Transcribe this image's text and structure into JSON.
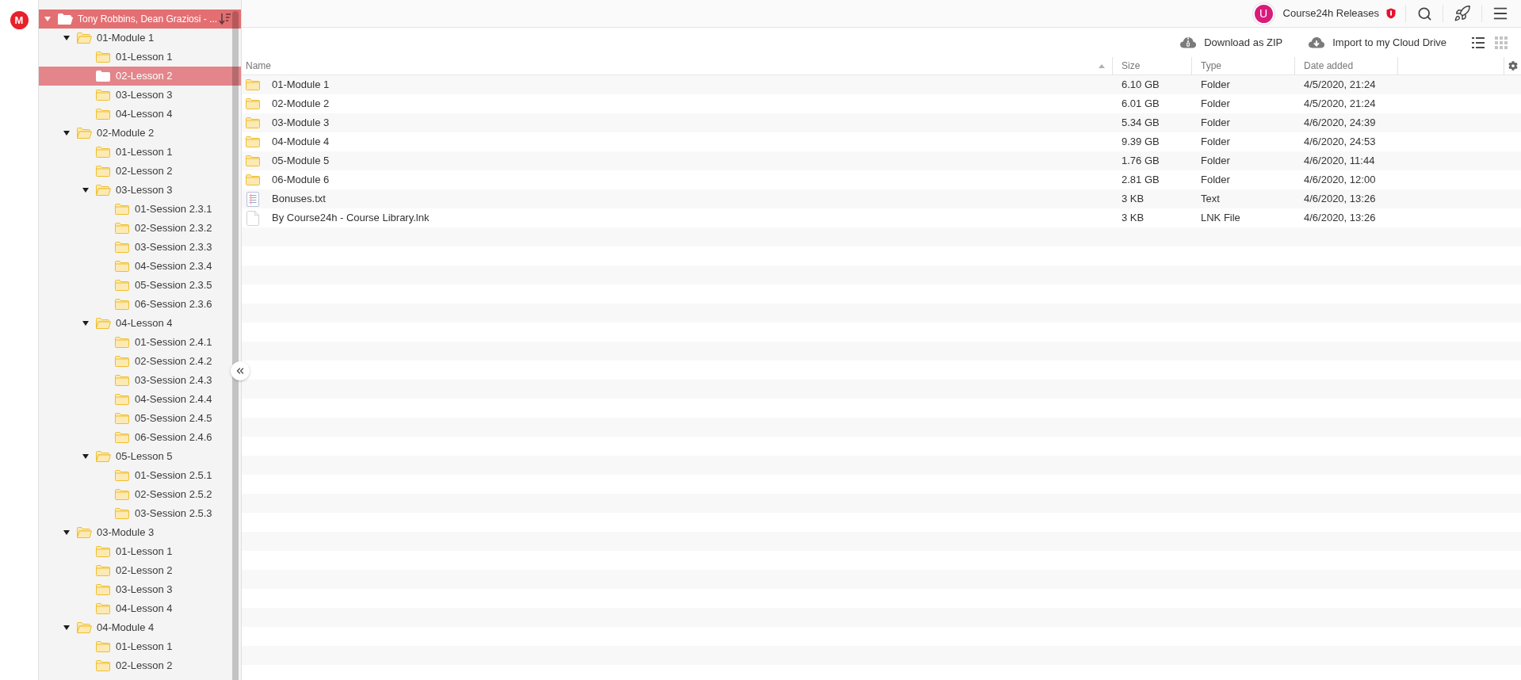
{
  "logo": {
    "text": "M"
  },
  "sidebar": {
    "root": {
      "label": "Tony Robbins, Dean Graziosi - ...",
      "expanded": true,
      "selected": true,
      "children": [
        {
          "label": "01-Module 1",
          "expanded": true,
          "selected": false,
          "hovered": false,
          "children": [
            {
              "label": "01-Lesson 1",
              "selected": false,
              "hovered": false
            },
            {
              "label": "02-Lesson 2",
              "selected": false,
              "hovered": true
            },
            {
              "label": "03-Lesson 3",
              "selected": false,
              "hovered": false
            },
            {
              "label": "04-Lesson 4",
              "selected": false,
              "hovered": false
            }
          ]
        },
        {
          "label": "02-Module 2",
          "expanded": true,
          "selected": false,
          "hovered": false,
          "children": [
            {
              "label": "01-Lesson 1",
              "selected": false,
              "hovered": false
            },
            {
              "label": "02-Lesson 2",
              "selected": false,
              "hovered": false
            },
            {
              "label": "03-Lesson 3",
              "expanded": true,
              "selected": false,
              "hovered": false,
              "children": [
                {
                  "label": "01-Session 2.3.1",
                  "selected": false,
                  "hovered": false
                },
                {
                  "label": "02-Session 2.3.2",
                  "selected": false,
                  "hovered": false
                },
                {
                  "label": "03-Session 2.3.3",
                  "selected": false,
                  "hovered": false
                },
                {
                  "label": "04-Session 2.3.4",
                  "selected": false,
                  "hovered": false
                },
                {
                  "label": "05-Session 2.3.5",
                  "selected": false,
                  "hovered": false
                },
                {
                  "label": "06-Session 2.3.6",
                  "selected": false,
                  "hovered": false
                }
              ]
            },
            {
              "label": "04-Lesson 4",
              "expanded": true,
              "selected": false,
              "hovered": false,
              "children": [
                {
                  "label": "01-Session 2.4.1",
                  "selected": false,
                  "hovered": false
                },
                {
                  "label": "02-Session 2.4.2",
                  "selected": false,
                  "hovered": false
                },
                {
                  "label": "03-Session 2.4.3",
                  "selected": false,
                  "hovered": false
                },
                {
                  "label": "04-Session 2.4.4",
                  "selected": false,
                  "hovered": false
                },
                {
                  "label": "05-Session 2.4.5",
                  "selected": false,
                  "hovered": false
                },
                {
                  "label": "06-Session 2.4.6",
                  "selected": false,
                  "hovered": false
                }
              ]
            },
            {
              "label": "05-Lesson 5",
              "expanded": true,
              "selected": false,
              "hovered": false,
              "children": [
                {
                  "label": "01-Session 2.5.1",
                  "selected": false,
                  "hovered": false
                },
                {
                  "label": "02-Session 2.5.2",
                  "selected": false,
                  "hovered": false
                },
                {
                  "label": "03-Session 2.5.3",
                  "selected": false,
                  "hovered": false
                }
              ]
            }
          ]
        },
        {
          "label": "03-Module 3",
          "expanded": true,
          "selected": false,
          "hovered": false,
          "children": [
            {
              "label": "01-Lesson 1",
              "selected": false,
              "hovered": false
            },
            {
              "label": "02-Lesson 2",
              "selected": false,
              "hovered": false
            },
            {
              "label": "03-Lesson 3",
              "selected": false,
              "hovered": false
            },
            {
              "label": "04-Lesson 4",
              "selected": false,
              "hovered": false
            }
          ]
        },
        {
          "label": "04-Module 4",
          "expanded": true,
          "selected": false,
          "hovered": false,
          "children": [
            {
              "label": "01-Lesson 1",
              "selected": false,
              "hovered": false
            },
            {
              "label": "02-Lesson 2",
              "selected": false,
              "hovered": false
            }
          ]
        }
      ]
    }
  },
  "top_bar": {
    "account": {
      "initial": "U",
      "name": "Course24h Releases"
    }
  },
  "toolbar": {
    "actions": [
      {
        "kind": "zip",
        "label": "Download as ZIP"
      },
      {
        "kind": "import",
        "label": "Import to my Cloud Drive"
      }
    ],
    "view_modes": [
      {
        "kind": "list",
        "selected": true
      },
      {
        "kind": "grid",
        "selected": false
      }
    ]
  },
  "table": {
    "columns": [
      {
        "label": "Name",
        "sorted": true
      },
      {
        "label": "Size",
        "sorted": false
      },
      {
        "label": "Type",
        "sorted": false
      },
      {
        "label": "Date added",
        "sorted": false
      }
    ],
    "rows": [
      {
        "kind": "folder",
        "name": "01-Module 1",
        "size": "6.10 GB",
        "type": "Folder",
        "date_added": "4/5/2020, 21:24"
      },
      {
        "kind": "folder",
        "name": "02-Module 2",
        "size": "6.01 GB",
        "type": "Folder",
        "date_added": "4/5/2020, 21:24"
      },
      {
        "kind": "folder",
        "name": "03-Module 3",
        "size": "5.34 GB",
        "type": "Folder",
        "date_added": "4/6/2020, 24:39"
      },
      {
        "kind": "folder",
        "name": "04-Module 4",
        "size": "9.39 GB",
        "type": "Folder",
        "date_added": "4/6/2020, 24:53"
      },
      {
        "kind": "folder",
        "name": "05-Module 5",
        "size": "1.76 GB",
        "type": "Folder",
        "date_added": "4/6/2020, 11:44"
      },
      {
        "kind": "folder",
        "name": "06-Module 6",
        "size": "2.81 GB",
        "type": "Folder",
        "date_added": "4/6/2020, 12:00"
      },
      {
        "kind": "text",
        "name": "Bonuses.txt",
        "size": "3 KB",
        "type": "Text",
        "date_added": "4/6/2020, 13:26"
      },
      {
        "kind": "file",
        "name": "By Course24h - Course Library.lnk",
        "size": "3 KB",
        "type": "LNK File",
        "date_added": "4/6/2020, 13:26"
      }
    ]
  }
}
